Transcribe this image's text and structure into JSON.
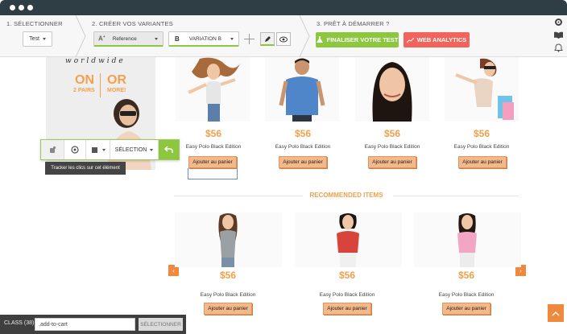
{
  "steps": {
    "step1": "1. SÉLECTIONNER",
    "step2": "2. CRÉER VOS VARIANTES",
    "step3": "3. PRÊT À DÉMARRER ?"
  },
  "toolbar": {
    "test_select": "Test",
    "reference_label": "Reference",
    "variation_label": "VARIATION B",
    "variation_prefix": "B",
    "finalize_label": "FINALISER VOTRE TEST",
    "analytics_label": "WEB ANALYTICS"
  },
  "banner": {
    "brand": "worldwide",
    "line1_left": "ON",
    "line1_right": "OR",
    "line2_left": "2 PAIRS",
    "line2_right": "MORE!"
  },
  "products_top": [
    {
      "price": "$56",
      "name": "Easy Polo Black Edition",
      "button": "Ajouter au panier"
    },
    {
      "price": "$56",
      "name": "Easy Polo Black Edition",
      "button": "Ajouter au panier"
    },
    {
      "price": "$56",
      "name": "Easy Polo Black Edition",
      "button": "Ajouter au panier"
    },
    {
      "price": "$56",
      "name": "Easy Polo Black Edition",
      "button": "Ajouter au panier"
    }
  ],
  "recommended": {
    "title": "RECOMMENDED ITEMS",
    "items": [
      {
        "price": "$56",
        "name": "Easy Polo Black Edition",
        "button": "Ajouter au panier"
      },
      {
        "price": "$56",
        "name": "Easy Polo Black Edition",
        "button": "Ajouter au panier"
      },
      {
        "price": "$56",
        "name": "Easy Polo Black Edition",
        "button": "Ajouter au panier"
      }
    ]
  },
  "floating_toolbar": {
    "selection_label": "SÉLECTION",
    "tooltip": "Tracker les clics sur cet élément"
  },
  "class_bar": {
    "label": "CLASS (38)",
    "value": ".add-to-cart",
    "button": "SÉLECTIONNER"
  },
  "colors": {
    "accent_green": "#8dc63f",
    "accent_red": "#f1635b",
    "accent_orange": "#f0a04b",
    "titlebar": "#2f3e44"
  }
}
